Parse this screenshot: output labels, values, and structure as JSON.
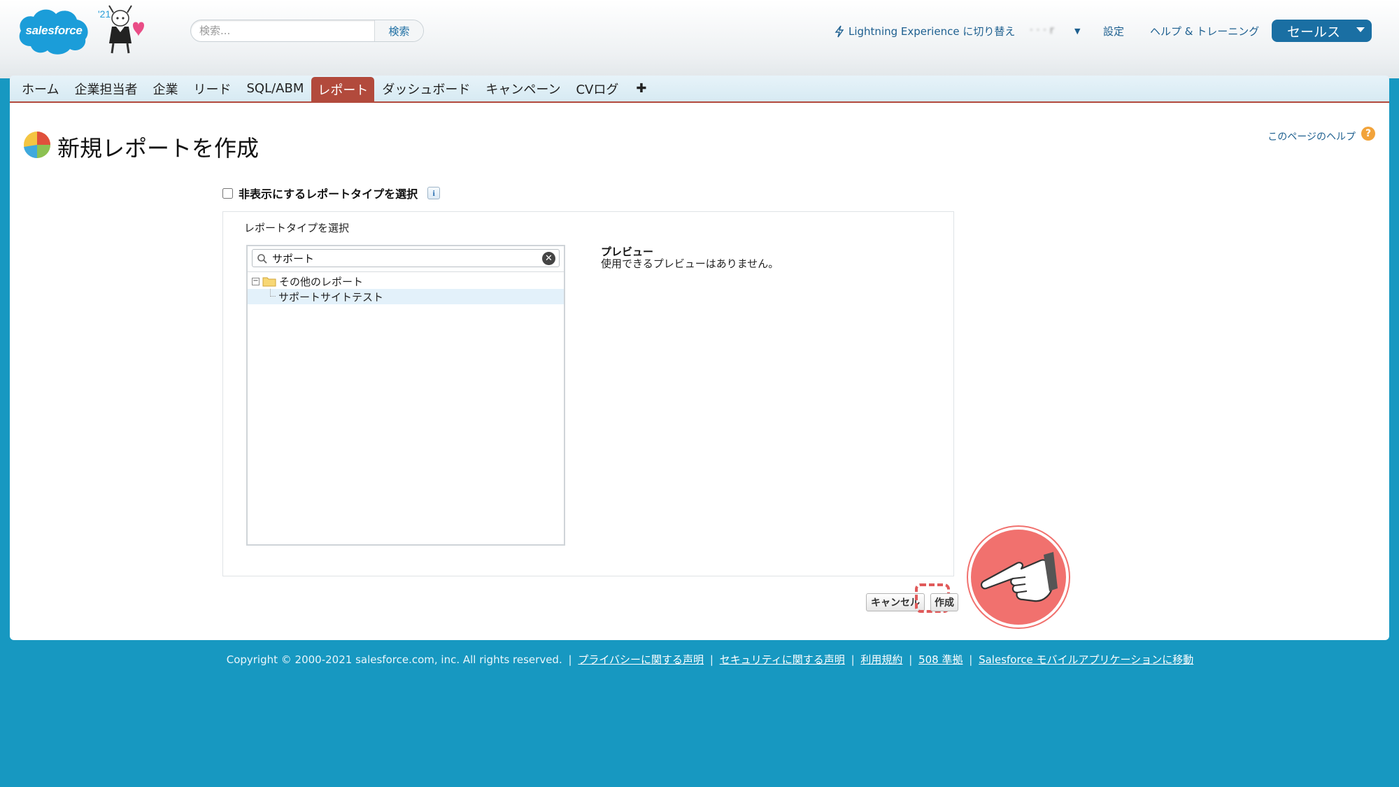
{
  "header": {
    "logo_text": "salesforce",
    "release_badge": "'21",
    "search_placeholder": "検索...",
    "search_button": "検索",
    "lightning_switch": "Lightning Experience に切り替え",
    "user_name": "· · · r",
    "settings": "設定",
    "help_training": "ヘルプ & トレーニング",
    "app_name": "セールス"
  },
  "tabs": [
    {
      "label": "ホーム"
    },
    {
      "label": "企業担当者"
    },
    {
      "label": "企業"
    },
    {
      "label": "リード"
    },
    {
      "label": "SQL/ABM"
    },
    {
      "label": "レポート",
      "active": true
    },
    {
      "label": "ダッシュボード"
    },
    {
      "label": "キャンペーン"
    },
    {
      "label": "CVログ"
    },
    {
      "label": "✚"
    }
  ],
  "page": {
    "title": "新規レポートを作成",
    "help_link": "このページのヘルプ",
    "help_icon": "?",
    "hidden_types_label": "非表示にするレポートタイプを選択",
    "info_icon": "i",
    "report_type_heading": "レポートタイプを選択",
    "filter_value": "サポート",
    "folder_label": "その他のレポート",
    "item_label": "サポートサイトテスト",
    "preview_title": "プレビュー",
    "preview_text": "使用できるプレビューはありません。",
    "cancel_button": "キャンセル",
    "create_button": "作成"
  },
  "footer": {
    "copyright": "Copyright © 2000-2021 salesforce.com, inc. All rights reserved.",
    "links": [
      "プライバシーに関する声明",
      "セキュリティに関する声明",
      "利用規約",
      "508 準拠",
      "Salesforce モバイルアプリケーションに移動"
    ]
  },
  "colors": {
    "background": "#1798c1",
    "active_tab": "#b24a3c",
    "app_switcher": "#1a6fa3",
    "pointer_badge": "#f1716e"
  }
}
